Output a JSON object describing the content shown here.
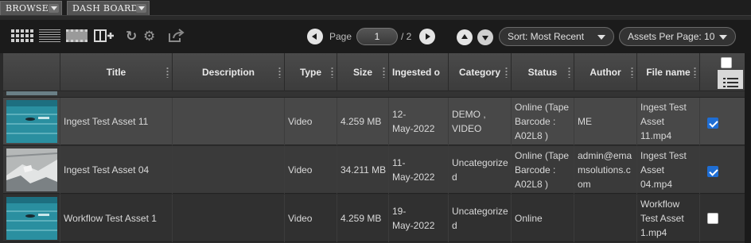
{
  "tabs": [
    {
      "label": "BROWSE"
    },
    {
      "label": "DASH BOARD"
    }
  ],
  "toolbar": {
    "icons": [
      "grid-view-icon",
      "list-view-icon",
      "filmstrip-view-icon",
      "add-column-icon",
      "refresh-icon",
      "gear-icon",
      "share-icon"
    ],
    "page_label": "Page",
    "page_value": "1",
    "page_total": "/ 2",
    "sort_label": "Sort: Most Recent",
    "per_page_label": "Assets Per Page: 10"
  },
  "table": {
    "columns": [
      "Title",
      "Description",
      "Type",
      "Size",
      "Ingested o",
      "Category",
      "Status",
      "Author",
      "File name"
    ],
    "rows": [
      {
        "title": "Ingest Test Asset 11",
        "description": "",
        "type": "Video",
        "size": "4.259 MB",
        "ingested": [
          "12-",
          "May-2022"
        ],
        "category": [
          "DEMO ,",
          "VIDEO"
        ],
        "status": [
          "Online (Tape",
          "Barcode :",
          "A02L8 )"
        ],
        "author": [
          "ME"
        ],
        "filename": [
          "Ingest Test",
          "Asset",
          "11.mp4"
        ],
        "checked": true,
        "thumb": "pool"
      },
      {
        "title": "Ingest Test Asset 04",
        "description": "",
        "type": "Video",
        "size": "34.211 MB",
        "ingested": [
          "11-",
          "May-2022"
        ],
        "category": [
          "Uncategorize",
          "d"
        ],
        "status": [
          "Online (Tape",
          "Barcode :",
          "A02L8 )"
        ],
        "author": [
          "admin@ema",
          "msolutions.c",
          "om"
        ],
        "filename": [
          "Ingest Test",
          "Asset",
          "04.mp4"
        ],
        "checked": true,
        "thumb": "snow"
      },
      {
        "title": "Workflow Test Asset 1",
        "description": "",
        "type": "Video",
        "size": "4.259 MB",
        "ingested": [
          "19-",
          "May-2022"
        ],
        "category": [
          "Uncategorize",
          "d"
        ],
        "status": [
          "Online"
        ],
        "author": [],
        "filename": [
          "Workflow",
          "Test Asset",
          "1.mp4"
        ],
        "checked": false,
        "thumb": "pool"
      }
    ]
  },
  "colors": {
    "checkbox_checked": "#1f6ed4",
    "row_highlight": "#484848",
    "row_normal": "#303030",
    "toolbar_bg": "#1b1b1b"
  }
}
